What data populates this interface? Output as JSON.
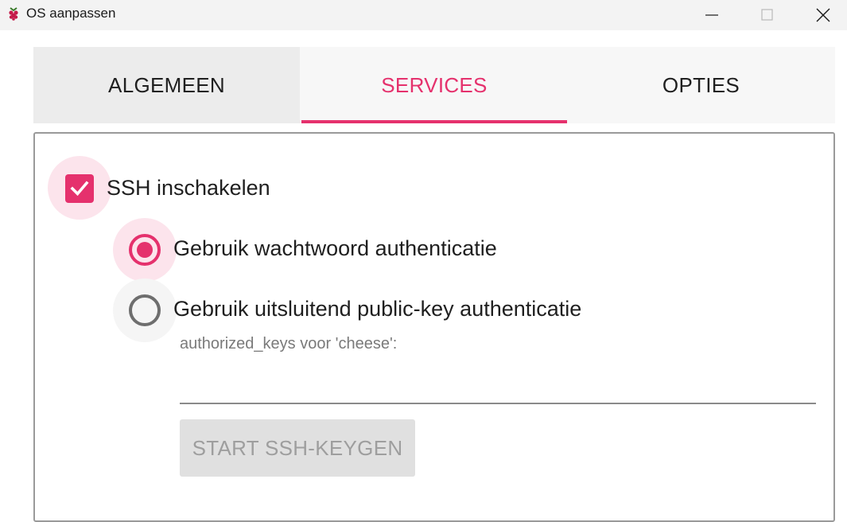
{
  "window": {
    "title": "OS aanpassen",
    "app_icon": "raspberry-pi-icon",
    "controls": [
      "minimize-icon",
      "maximize-icon",
      "close-icon"
    ]
  },
  "tabs": [
    {
      "label": "ALGEMEEN",
      "active": false
    },
    {
      "label": "SERVICES",
      "active": true
    },
    {
      "label": "OPTIES",
      "active": false
    }
  ],
  "ssh": {
    "enable_label": "SSH inschakelen",
    "enabled": true,
    "auth_options": [
      {
        "label": "Gebruik wachtwoord authenticatie",
        "selected": true
      },
      {
        "label": "Gebruik uitsluitend public-key authenticatie",
        "selected": false
      }
    ],
    "authorized_keys_label": "authorized_keys voor 'cheese':",
    "authorized_keys_value": "",
    "keygen_button": "START SSH-KEYGEN",
    "keygen_enabled": false
  },
  "colors": {
    "accent": "#e5316d",
    "accent_halo": "#fce4ec",
    "disabled_bg": "#e0e0e0",
    "disabled_text": "#9e9e9e"
  }
}
